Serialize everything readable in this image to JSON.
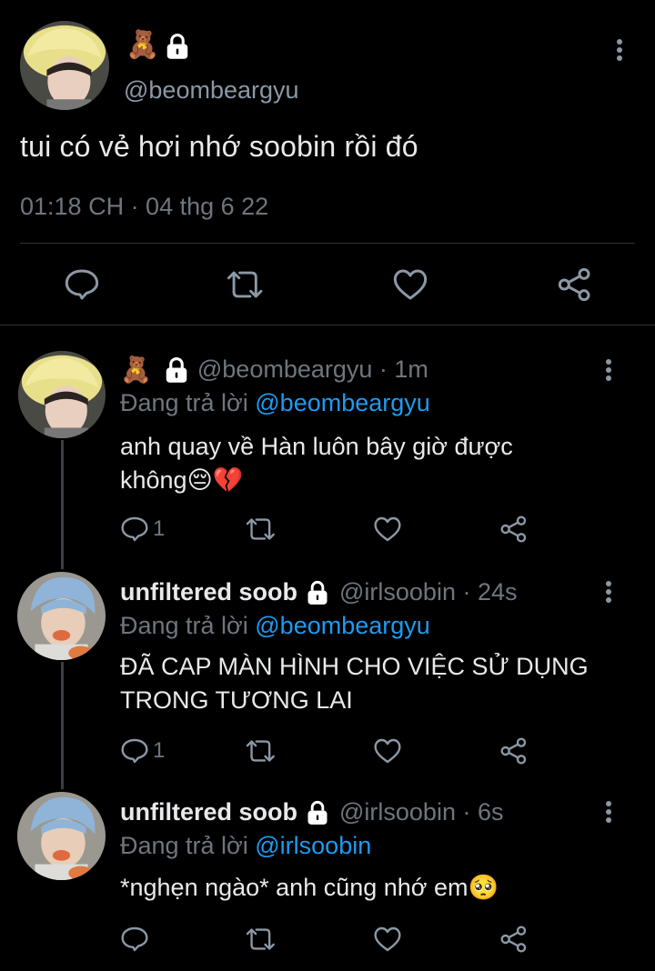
{
  "main_tweet": {
    "emoji": "🧸",
    "handle": "@beombeargyu",
    "text": "tui có vẻ hơi nhớ soobin rồi đó",
    "timestamp": "01:18 CH · 04 thg 6 22"
  },
  "replies": [
    {
      "emoji": "🧸",
      "name": "",
      "handle_time": "@beombeargyu · 1m",
      "reply_prefix": "Đang trả lời ",
      "reply_to": "@beombeargyu",
      "text_line1": "anh quay về Hàn luôn bây giờ được",
      "text_line2": "không😔💔",
      "reply_count": "1"
    },
    {
      "name": "unfiltered soob",
      "handle_time": "@irlsoobin · 24s",
      "reply_prefix": "Đang trả lời ",
      "reply_to": "@beombeargyu",
      "text_line1": "ĐÃ CAP MÀN HÌNH CHO VIỆC SỬ DỤNG",
      "text_line2": "TRONG TƯƠNG LAI",
      "reply_count": "1"
    },
    {
      "name": "unfiltered soob",
      "handle_time": "@irlsoobin · 6s",
      "reply_prefix": "Đang trả lời ",
      "reply_to": "@irlsoobin",
      "text_line1": "*nghẹn ngào* anh cũng nhớ em🥺",
      "reply_count": ""
    }
  ],
  "colors": {
    "background": "#000000",
    "text": "#e7e9ea",
    "muted": "#6e767d",
    "link": "#1d9bf0",
    "divider": "#2f3336"
  },
  "icons": [
    "more-vertical-icon",
    "lock-icon",
    "reply-icon",
    "retweet-icon",
    "like-icon",
    "share-icon"
  ]
}
